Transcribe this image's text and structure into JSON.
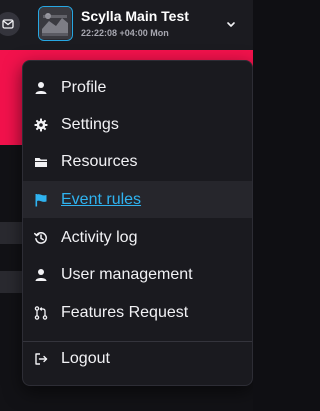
{
  "header": {
    "title": "Scylla Main Test",
    "subtitle": "22:22:08 +04:00 Mon"
  },
  "menu": {
    "items": [
      {
        "label": "Profile",
        "icon": "user-icon"
      },
      {
        "label": "Settings",
        "icon": "gear-icon"
      },
      {
        "label": "Resources",
        "icon": "folder-icon"
      },
      {
        "label": "Event rules",
        "icon": "flag-icon",
        "active": true
      },
      {
        "label": "Activity log",
        "icon": "history-icon"
      },
      {
        "label": "User management",
        "icon": "user-icon"
      },
      {
        "label": "Features Request",
        "icon": "pull-request-icon"
      }
    ],
    "logout": {
      "label": "Logout",
      "icon": "logout-icon"
    }
  },
  "colors": {
    "accent": "#2fb3f0",
    "brand_red": "#f2124c",
    "menu_bg": "#1a1a1f"
  }
}
